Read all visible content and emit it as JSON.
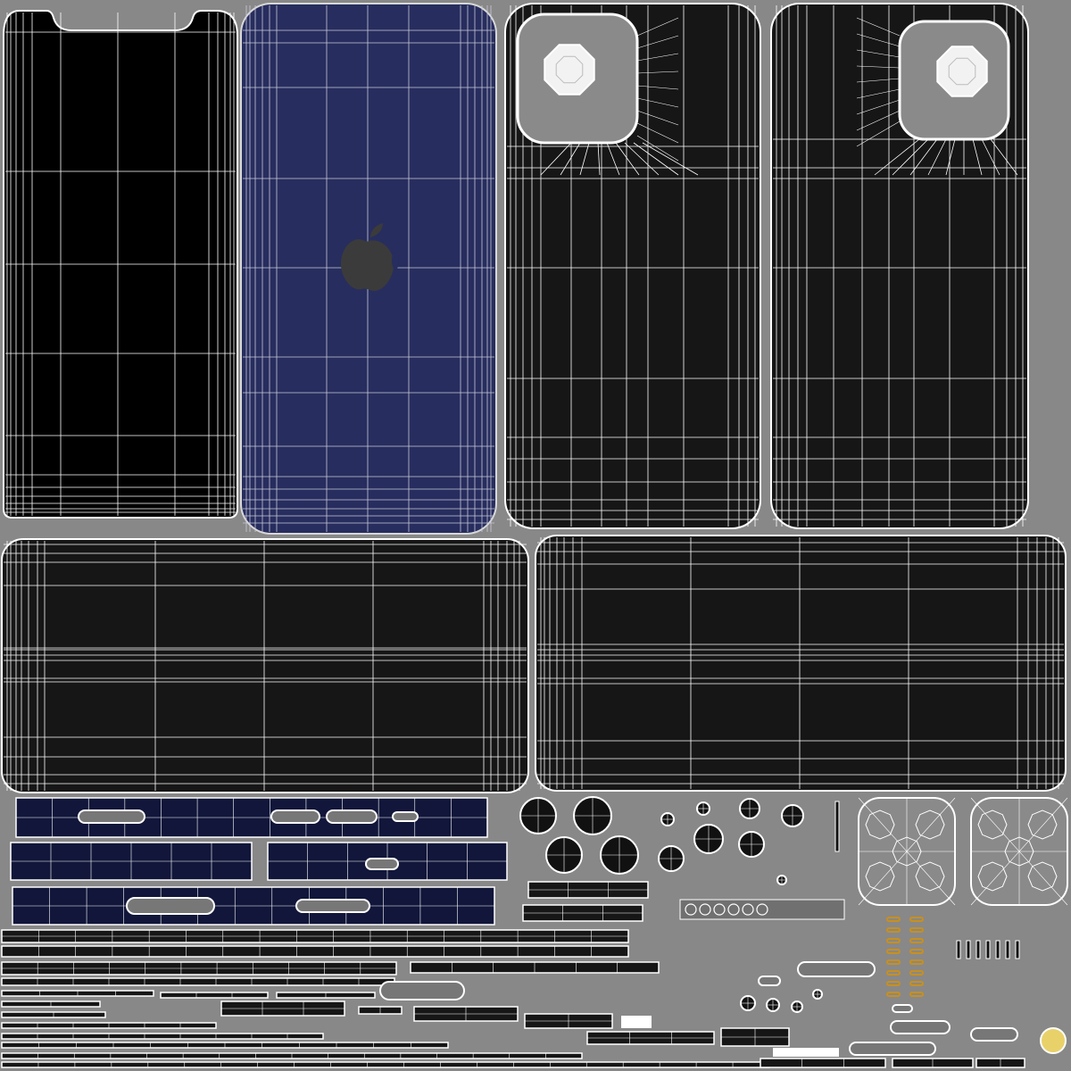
{
  "colors": {
    "background": "#888888",
    "panel_black": "#000000",
    "panel_dark": "#161616",
    "panel_blue": "#272d5e",
    "strip_navy": "#11163a",
    "wire": "#ffffff",
    "wire_dim": "#d8d8d8",
    "camera_plate": "#8a8a8a",
    "gold_pad": "#c8901e",
    "logo_gray": "#3b3b3b",
    "speaker_gray": "#707070",
    "sensor_yellow": "#e9d16a"
  },
  "icons": {
    "logo": "apple-logo-icon",
    "lens": "camera-lens-icon"
  }
}
